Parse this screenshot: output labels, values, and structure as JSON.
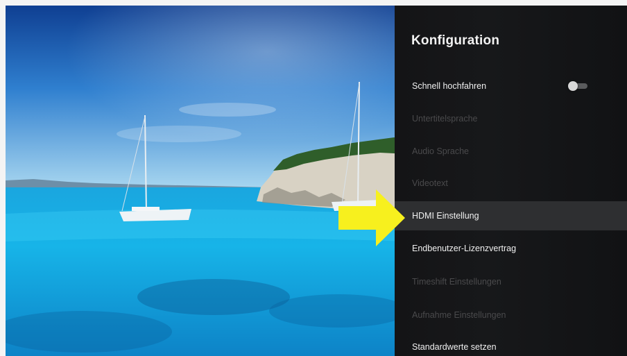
{
  "settings_panel": {
    "title": "Konfiguration",
    "items": [
      {
        "label": "Schnell hochfahren",
        "enabled": true,
        "selected": false,
        "toggle": "off"
      },
      {
        "label": "Untertitelsprache",
        "enabled": false,
        "selected": false
      },
      {
        "label": "Audio Sprache",
        "enabled": false,
        "selected": false
      },
      {
        "label": "Videotext",
        "enabled": false,
        "selected": false
      },
      {
        "label": "HDMI Einstellung",
        "enabled": true,
        "selected": true
      },
      {
        "label": "Endbenutzer-Lizenzvertrag",
        "enabled": true,
        "selected": false
      },
      {
        "label": "Timeshift Einstellungen",
        "enabled": false,
        "selected": false
      },
      {
        "label": "Aufnahme Einstellungen",
        "enabled": false,
        "selected": false
      },
      {
        "label": "Standardwerte setzen",
        "enabled": true,
        "selected": false
      }
    ]
  },
  "colors": {
    "panel_background": "#17181a",
    "selected_row": "#2e2f31",
    "disabled_text": "#4a4a4c",
    "enabled_text": "#f0f0f0",
    "annotation_arrow": "#f7f01e"
  },
  "annotation": {
    "icon": "arrow-right-icon",
    "points_to": "HDMI Einstellung"
  }
}
